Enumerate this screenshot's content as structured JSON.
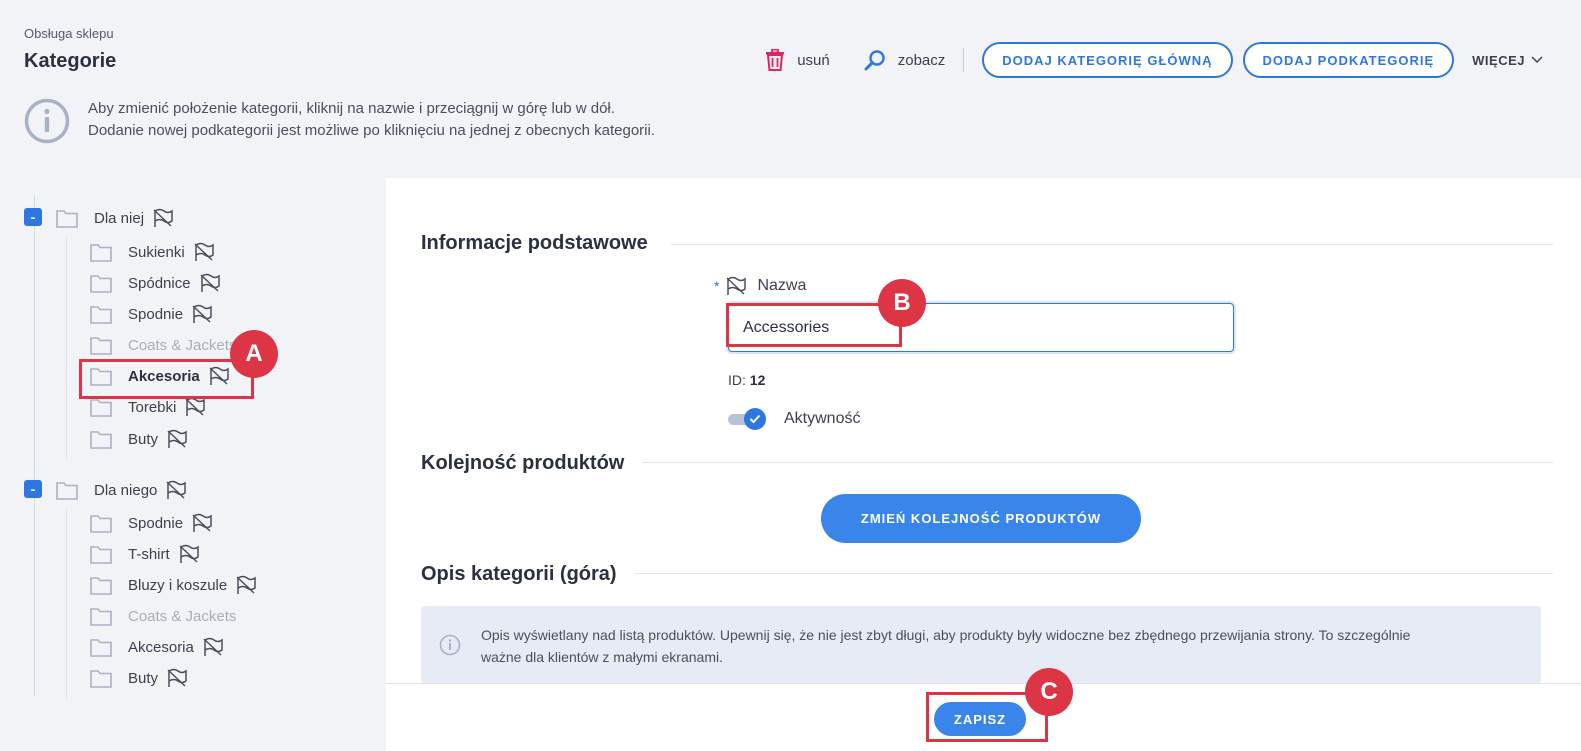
{
  "header": {
    "breadcrumb": "Obsługa sklepu",
    "title": "Kategorie"
  },
  "toolbar": {
    "delete_label": "usuń",
    "view_label": "zobacz",
    "add_main_label": "DODAJ KATEGORIĘ GŁÓWNĄ",
    "add_sub_label": "DODAJ PODKATEGORIĘ",
    "more_label": "WIĘCEJ"
  },
  "info": {
    "line1": "Aby zmienić położenie kategorii, kliknij na nazwie i przeciągnij w górę lub w dół.",
    "line2": "Dodanie nowej podkategorii jest możliwe po kliknięciu na jednej z obecnych kategorii."
  },
  "tree": {
    "groups": [
      {
        "toggle": "-",
        "label": "Dla niej",
        "children": [
          "Sukienki",
          "Spódnice",
          "Spodnie",
          "Coats & Jackets",
          "Akcesoria",
          "Torebki",
          "Buty"
        ]
      },
      {
        "toggle": "-",
        "label": "Dla niego",
        "children": [
          "Spodnie",
          "T-shirt",
          "Bluzy i koszule",
          "Coats & Jackets",
          "Akcesoria",
          "Buty"
        ]
      }
    ]
  },
  "form": {
    "section_basic": "Informacje podstawowe",
    "required_mark": "*",
    "name_label": "Nazwa",
    "name_value": "Accessories",
    "id_label": "ID:",
    "id_value": "12",
    "active_label": "Aktywność",
    "section_order": "Kolejność produktów",
    "order_button": "ZMIEŃ KOLEJNOŚĆ PRODUKTÓW",
    "section_desc": "Opis kategorii (góra)",
    "desc_info_line1": "Opis wyświetlany nad listą produktów. Upewnij się, że nie jest zbyt długi, aby produkty były widoczne bez zbędnego przewijania strony. To szczególnie",
    "desc_info_line2": "ważne dla klientów z małymi ekranami.",
    "save_button": "ZAPISZ"
  },
  "callouts": {
    "a": "A",
    "b": "B",
    "c": "C"
  },
  "colors": {
    "accent": "#2f77e0",
    "callout": "#dc3545",
    "delete_icon": "#e0245e"
  }
}
